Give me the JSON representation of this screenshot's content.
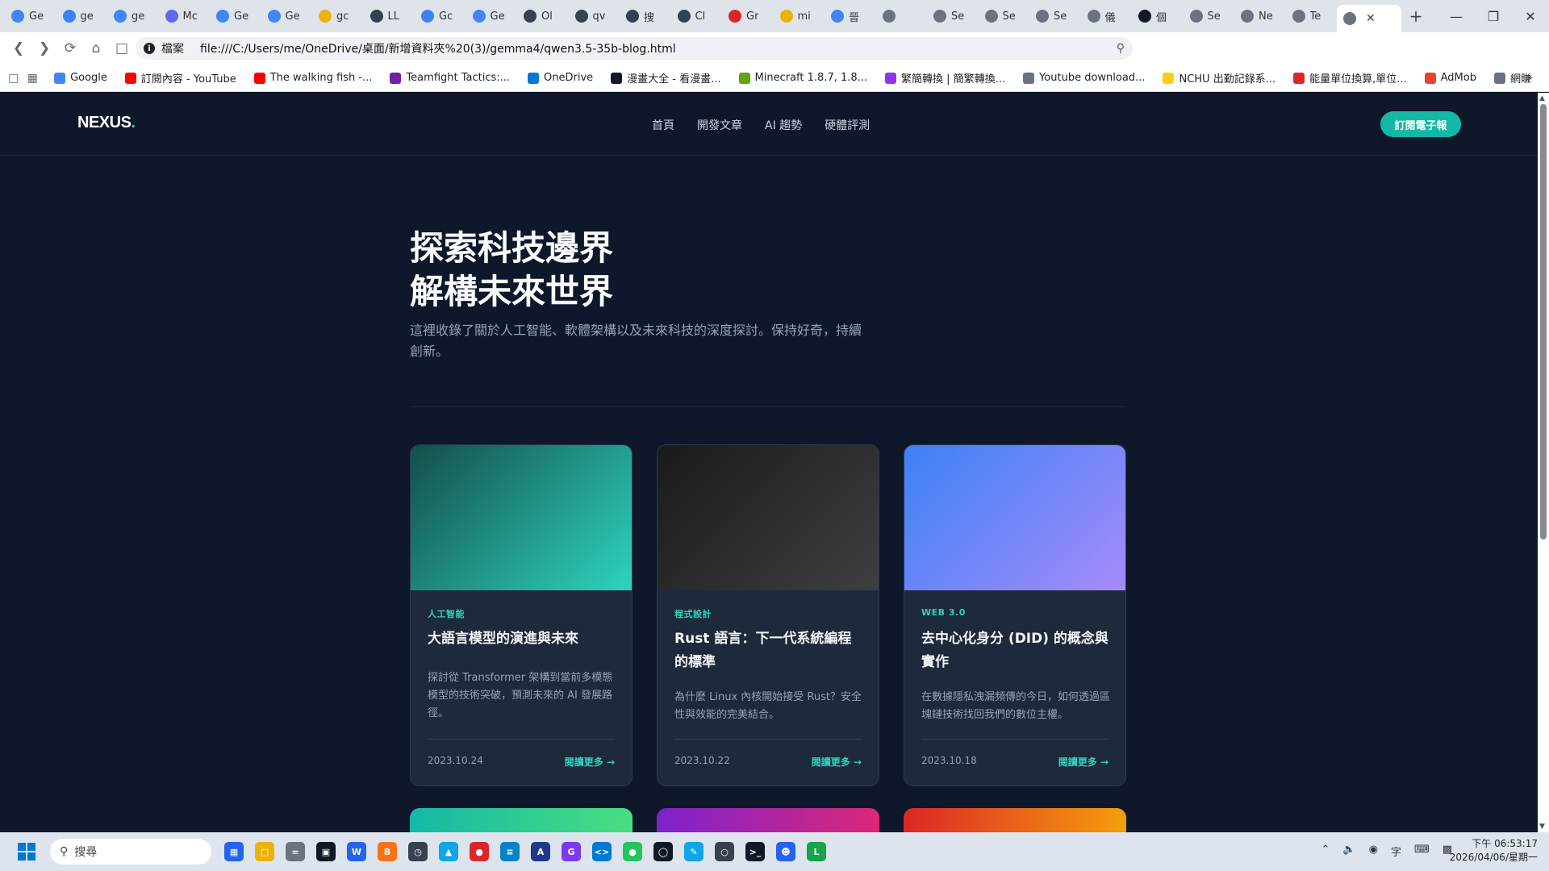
{
  "browser": {
    "tabs": [
      {
        "label": "Ge",
        "icon": "google-icon",
        "color": "#4285f4"
      },
      {
        "label": "ge",
        "icon": "gemini-icon",
        "color": "#3b82f6"
      },
      {
        "label": "ge",
        "icon": "google-icon",
        "color": "#4285f4"
      },
      {
        "label": "Mc",
        "icon": "copilot-icon",
        "color": "#6366f1"
      },
      {
        "label": "Ge",
        "icon": "google-icon",
        "color": "#4285f4"
      },
      {
        "label": "Ge",
        "icon": "google-icon",
        "color": "#4285f4"
      },
      {
        "label": "gc",
        "icon": "face-icon",
        "color": "#eab308"
      },
      {
        "label": "LL",
        "icon": "arena-icon",
        "color": "#334155"
      },
      {
        "label": "Gc",
        "icon": "gemini-icon",
        "color": "#3b82f6"
      },
      {
        "label": "Ge",
        "icon": "google-icon",
        "color": "#4285f4"
      },
      {
        "label": "Ol",
        "icon": "ollama-icon",
        "color": "#374151"
      },
      {
        "label": "qv",
        "icon": "ollama-icon",
        "color": "#374151"
      },
      {
        "label": "搜",
        "icon": "arena-icon",
        "color": "#334155"
      },
      {
        "label": "Cl",
        "icon": "arena-icon",
        "color": "#334155"
      },
      {
        "label": "Gr",
        "icon": "bolt-icon",
        "color": "#dc2626"
      },
      {
        "label": "mi",
        "icon": "face-icon",
        "color": "#eab308"
      },
      {
        "label": "晉",
        "icon": "google-icon",
        "color": "#4285f4"
      },
      {
        "label": "",
        "icon": "globe-icon",
        "color": "#6b7280"
      },
      {
        "label": "Se",
        "icon": "globe-icon",
        "color": "#6b7280"
      },
      {
        "label": "Se",
        "icon": "globe-icon",
        "color": "#6b7280"
      },
      {
        "label": "Se",
        "icon": "globe-icon",
        "color": "#6b7280"
      },
      {
        "label": "儀",
        "icon": "globe-icon",
        "color": "#6b7280"
      },
      {
        "label": "個",
        "icon": "github-icon",
        "color": "#111827"
      },
      {
        "label": "Se",
        "icon": "globe-icon",
        "color": "#6b7280"
      },
      {
        "label": "Ne",
        "icon": "globe-icon",
        "color": "#6b7280"
      },
      {
        "label": "Te",
        "icon": "globe-icon",
        "color": "#6b7280"
      }
    ],
    "active_tab_icon": "globe-icon",
    "address": {
      "protocol_label": "檔案",
      "url": "file:///C:/Users/me/OneDrive/桌面/新增資料夾%20(3)/gemma4/qwen3.5-35b-blog.html"
    },
    "bookmarks": [
      {
        "label": "Google",
        "color": "#4285f4"
      },
      {
        "label": "訂閱內容 - YouTube",
        "color": "#ff0000"
      },
      {
        "label": "The walking fish -...",
        "color": "#ff0000"
      },
      {
        "label": "Teamfight Tactics:...",
        "color": "#6b21a8"
      },
      {
        "label": "OneDrive",
        "color": "#0078d4"
      },
      {
        "label": "漫畫大全 - 看漫畫...",
        "color": "#111827"
      },
      {
        "label": "Minecraft 1.8.7, 1.8...",
        "color": "#65a30d"
      },
      {
        "label": "繁簡轉換 | 簡繁轉換...",
        "color": "#9333ea"
      },
      {
        "label": "Youtube download...",
        "color": "#6b7280"
      },
      {
        "label": "NCHU 出勤記錄系...",
        "color": "#facc15"
      },
      {
        "label": "能量單位換算,單位...",
        "color": "#dc2626"
      },
      {
        "label": "AdMob",
        "color": "#ea4335"
      },
      {
        "label": "網賺",
        "color": "#6b7280"
      }
    ]
  },
  "site": {
    "logo": "NEXUS",
    "logo_dot": ".",
    "nav": [
      "首頁",
      "開發文章",
      "AI 趨勢",
      "硬體評測"
    ],
    "subscribe_label": "訂閱電子報",
    "hero_line1": "探索科技邊界",
    "hero_line2": "解構未來世界",
    "hero_desc": "這裡收錄了關於人工智能、軟體架構以及未來科技的深度探討。保持好奇，持續創新。",
    "cards": [
      {
        "category": "人工智能",
        "title": "大語言模型的演進與未來",
        "excerpt": "探討從 Transformer 架構到當前多模態模型的技術突破，預測未來的 AI 發展路徑。",
        "date": "2023.10.24",
        "more": "閱讀更多 →",
        "gradient": [
          "#134e4a",
          "#2dd4bf"
        ]
      },
      {
        "category": "程式設計",
        "title": "Rust 語言：下一代系統編程的標準",
        "excerpt": "為什麼 Linux 內核開始接受 Rust？安全性與效能的完美結合。",
        "date": "2023.10.22",
        "more": "閱讀更多 →",
        "gradient": [
          "#1a1a1a",
          "#3f3f3f"
        ]
      },
      {
        "category": "WEB 3.0",
        "title": "去中心化身分 (DID) 的概念與實作",
        "excerpt": "在數據隱私洩漏頻傳的今日，如何透過區塊鏈技術找回我們的數位主權。",
        "date": "2023.10.18",
        "more": "閱讀更多 →",
        "gradient": [
          "#3b82f6",
          "#a78bfa"
        ]
      }
    ],
    "next_row_gradients": [
      [
        "#14b8a6",
        "#4ade80"
      ],
      [
        "#7e22ce",
        "#db2777"
      ],
      [
        "#dc2626",
        "#f59e0b"
      ]
    ]
  },
  "taskbar": {
    "search_placeholder": "搜尋",
    "clock_time": "下午 06:53:17",
    "clock_date": "2026/04/06/星期一"
  }
}
